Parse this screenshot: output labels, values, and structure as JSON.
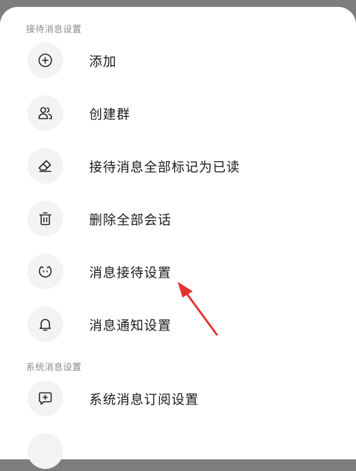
{
  "sections": [
    {
      "title": "接待消息设置",
      "items": [
        {
          "label": "添加",
          "icon": "plus-circle-icon"
        },
        {
          "label": "创建群",
          "icon": "group-icon"
        },
        {
          "label": "接待消息全部标记为已读",
          "icon": "eraser-icon"
        },
        {
          "label": "删除全部会话",
          "icon": "trash-icon"
        },
        {
          "label": "消息接待设置",
          "icon": "smiley-icon"
        },
        {
          "label": "消息通知设置",
          "icon": "bell-icon"
        }
      ]
    },
    {
      "title": "系统消息设置",
      "items": [
        {
          "label": "系统消息订阅设置",
          "icon": "message-plus-icon"
        }
      ]
    }
  ],
  "colors": {
    "overlay": "#7d7d7d",
    "sheet": "#ffffff",
    "icon_bg": "#f3f3f5",
    "annotation_arrow": "#e5312f"
  }
}
